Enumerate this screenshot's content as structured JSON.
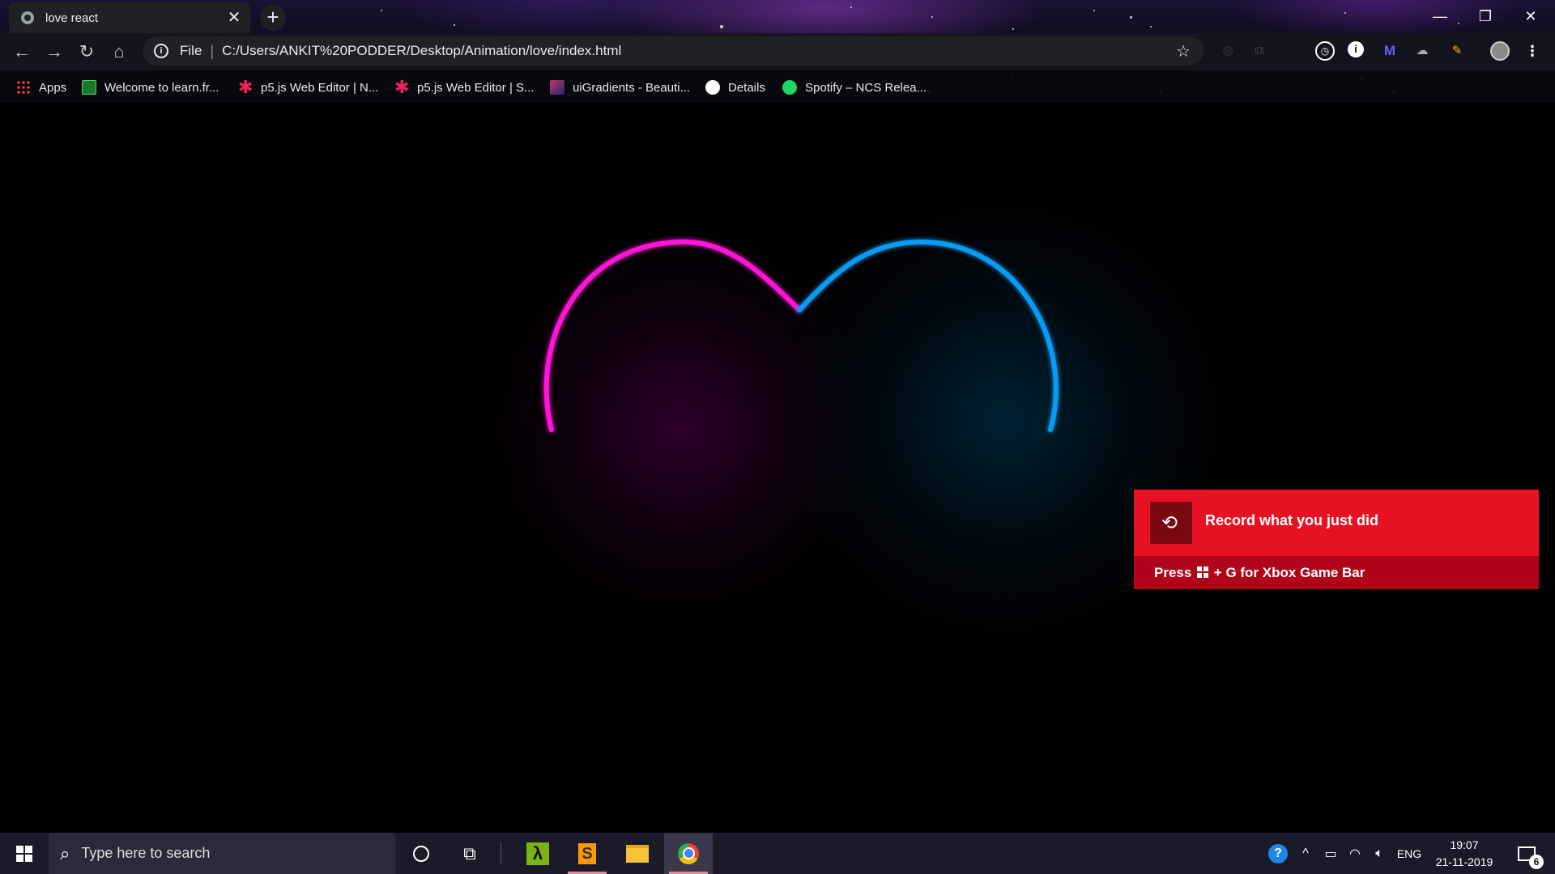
{
  "browser": {
    "tab_title": "love react",
    "omnibox": {
      "scheme": "File",
      "url": "C:/Users/ANKIT%20PODDER/Desktop/Animation/love/index.html"
    },
    "bookmarks": [
      {
        "label": "Apps",
        "icon": "apps-grid-icon"
      },
      {
        "label": "Welcome to learn.fr...",
        "icon": "learn-icon"
      },
      {
        "label": "p5.js Web Editor | N...",
        "icon": "p5js-icon"
      },
      {
        "label": "p5.js Web Editor | S...",
        "icon": "p5js-icon"
      },
      {
        "label": "uiGradients - Beauti...",
        "icon": "uigradients-icon"
      },
      {
        "label": "Details",
        "icon": "globe-icon"
      },
      {
        "label": "Spotify – NCS Relea...",
        "icon": "spotify-icon"
      }
    ]
  },
  "page": {
    "heart_colors": {
      "left": "#ff14d8",
      "right": "#0a9cf4"
    }
  },
  "toast": {
    "headline": "Record what you just did",
    "hint_prefix": "Press",
    "hint_suffix": "+ G for Xbox Game Bar",
    "color": "#e81123"
  },
  "taskbar": {
    "search_placeholder": "Type here to search",
    "language": "ENG",
    "time": "19:07",
    "date": "21-11-2019",
    "notifications_count": "6"
  }
}
